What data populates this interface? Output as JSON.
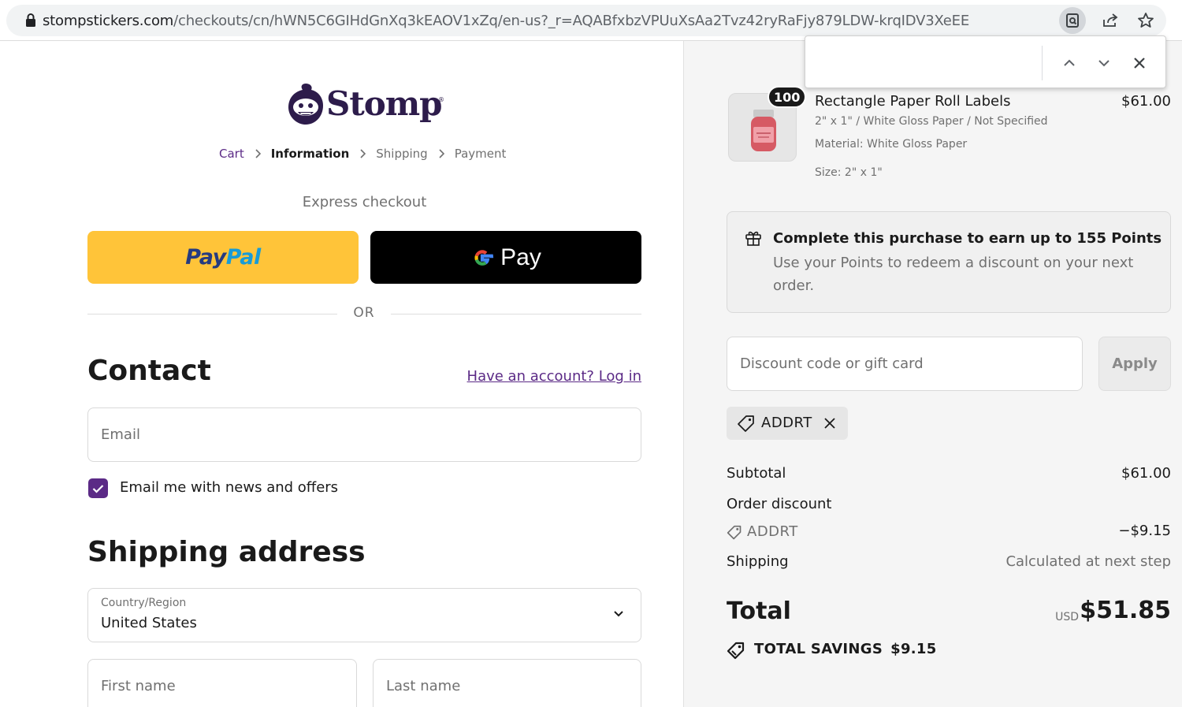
{
  "browser": {
    "url_host": "stompstickers.com",
    "url_path": "/checkouts/cn/hWN5C6GIHdGnXq3kEAOV1xZq/en-us?_r=AQABfxbzVPUuXsAa2Tvz42ryRaFjy879LDW-krqIDV3XeEE"
  },
  "brand": {
    "name": "Stomp",
    "trademark": "®"
  },
  "breadcrumb": [
    "Cart",
    "Information",
    "Shipping",
    "Payment"
  ],
  "express": {
    "label": "Express checkout",
    "paypal_part1": "Pay",
    "paypal_part2": "Pal",
    "gpay_label": "Pay",
    "or_label": "OR"
  },
  "contact": {
    "heading": "Contact",
    "login_link": "Have an account? Log in",
    "email_placeholder": "Email",
    "newsletter_label": "Email me with news and offers",
    "newsletter_checked": true
  },
  "shipping_address": {
    "heading": "Shipping address",
    "country_label": "Country/Region",
    "country_value": "United States",
    "first_name_placeholder": "First name",
    "last_name_placeholder": "Last name"
  },
  "order": {
    "item": {
      "quantity": "100",
      "name": "Rectangle Paper Roll Labels",
      "variant": "2\" x 1\" / White Gloss Paper / Not Specified",
      "material": "Material: White Gloss Paper",
      "size": "Size: 2\" x 1\"",
      "price": "$61.00"
    },
    "points": {
      "title": "Complete this purchase to earn up to 155 Points",
      "description": "Use your Points to redeem a discount on your next order."
    },
    "discount_placeholder": "Discount code or gift card",
    "apply_label": "Apply",
    "applied_code": "ADDRT",
    "subtotal_label": "Subtotal",
    "subtotal_value": "$61.00",
    "order_discount_label": "Order discount",
    "order_discount_code": "ADDRT",
    "order_discount_value": "−$9.15",
    "shipping_label": "Shipping",
    "shipping_value": "Calculated at next step",
    "total_label": "Total",
    "currency": "USD",
    "total_value": "$51.85",
    "savings_label": "TOTAL SAVINGS",
    "savings_value": "$9.15"
  },
  "colors": {
    "brand_purple": "#5b2a86",
    "paypal_yellow": "#ffc439",
    "sidebar_bg": "#f5f5f5"
  }
}
